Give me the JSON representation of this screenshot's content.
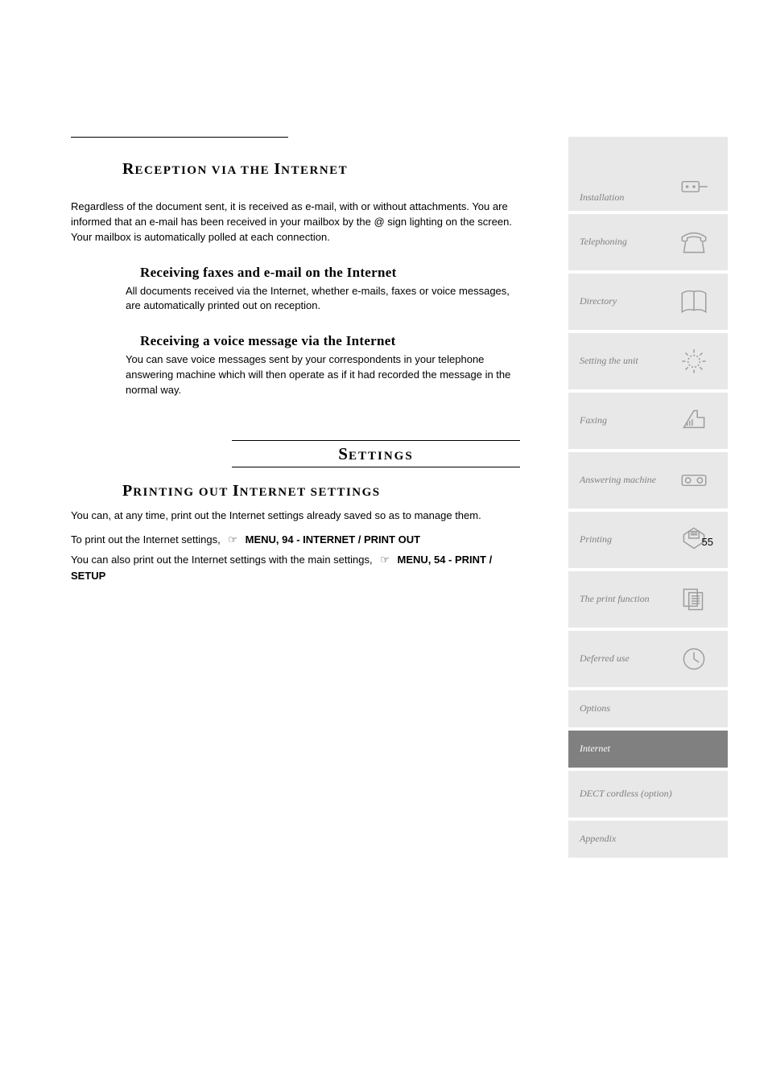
{
  "page_number": "55",
  "reception": {
    "heading_first_cap": "R",
    "heading_rest": "ECEPTION VIA THE ",
    "heading_second_cap": "I",
    "heading_rest2": "NTERNET",
    "intro": "Regardless of the document sent, it is received as e-mail, with or without attachments. You are informed that an e-mail has been received in your mailbox by the @ sign lighting on the screen. Your mailbox is automatically polled at each connection.",
    "sub1_title": "Receiving faxes and e-mail on the Internet",
    "sub1_text": "All documents received via the Internet, whether e-mails, faxes or voice messages, are automatically printed out on reception.",
    "sub2_title": "Receiving a voice message via the Internet",
    "sub2_text": "You can save voice messages sent by your correspondents in your telephone answering machine which will then operate as if it had recorded the message in the normal way."
  },
  "settings": {
    "title_first": "S",
    "title_rest": "ETTINGS",
    "subheading_first1": "P",
    "subheading_rest1": "RINTING OUT ",
    "subheading_first2": "I",
    "subheading_rest2": "NTERNET SETTINGS",
    "body": "You can, at any time, print out the Internet settings already saved so as to manage them.",
    "ref1_prefix": "To print out the Internet settings,",
    "ref1_menu": "MENU, 94 - INTERNET / PRINT OUT",
    "ref2_prefix": "You can also print out the Internet settings with the main settings,",
    "ref2_menu": "MENU, 54 - PRINT / SETUP"
  },
  "tabs": [
    {
      "label": "Installation",
      "icon": "socket"
    },
    {
      "label": "Telephoning",
      "icon": "phone"
    },
    {
      "label": "Directory",
      "icon": "book"
    },
    {
      "label": "Setting the unit",
      "icon": "sun"
    },
    {
      "label": "Faxing",
      "icon": "fax"
    },
    {
      "label": "Answering machine",
      "icon": "tape"
    },
    {
      "label": "Printing",
      "icon": "printer"
    },
    {
      "label": "The print function",
      "icon": "doc"
    },
    {
      "label": "Deferred use",
      "icon": "clock"
    },
    {
      "label": "Options",
      "icon": ""
    },
    {
      "label": "Internet",
      "icon": ""
    },
    {
      "label": "DECT cordless (option)",
      "icon": ""
    },
    {
      "label": "Appendix",
      "icon": ""
    }
  ],
  "active_tab_index": 10
}
